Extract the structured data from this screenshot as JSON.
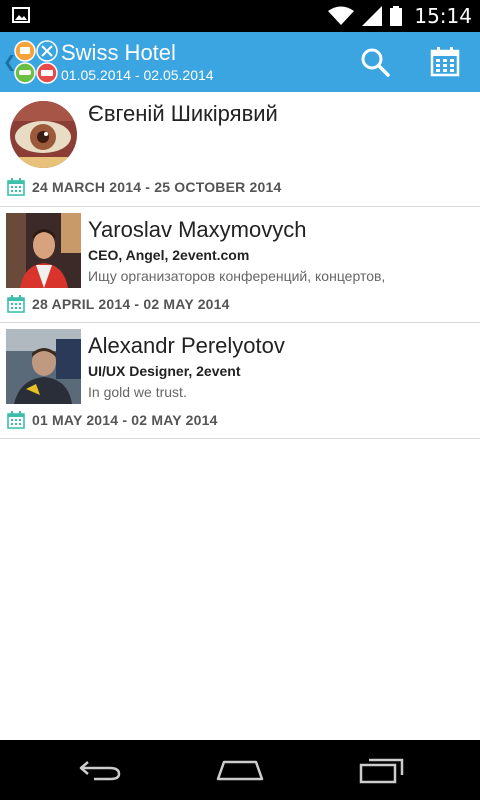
{
  "status_bar": {
    "time": "15:14",
    "icons": [
      "image-notification-icon",
      "wifi-icon",
      "signal-icon",
      "battery-icon"
    ]
  },
  "action_bar": {
    "title": "Swiss Hotel",
    "subtitle": "01.05.2014 - 02.05.2014",
    "background_color": "#3aa5e0",
    "actions": [
      "search-icon",
      "calendar-icon"
    ]
  },
  "attendees": [
    {
      "name": "Євгеній Шикірявий",
      "role": "",
      "description": "",
      "dates": "24 MARCH 2014 - 25 OCTOBER 2014"
    },
    {
      "name": "Yaroslav Maxymovych",
      "role": "CEO, Angel, 2event.com",
      "description": "Ищу организаторов конференций, концертов,",
      "dates": "28 APRIL 2014 - 02 MAY 2014"
    },
    {
      "name": "Alexandr Perelyotov",
      "role": "UI/UX Designer, 2event",
      "description": "In gold we trust.",
      "dates": "01 MAY 2014 - 02 MAY 2014"
    }
  ],
  "colors": {
    "accent": "#3aa5e0",
    "calendar_icon": "#3cbfa8",
    "divider": "#d7d7d7"
  },
  "nav_bar": {
    "buttons": [
      "back-icon",
      "home-icon",
      "recents-icon"
    ]
  }
}
